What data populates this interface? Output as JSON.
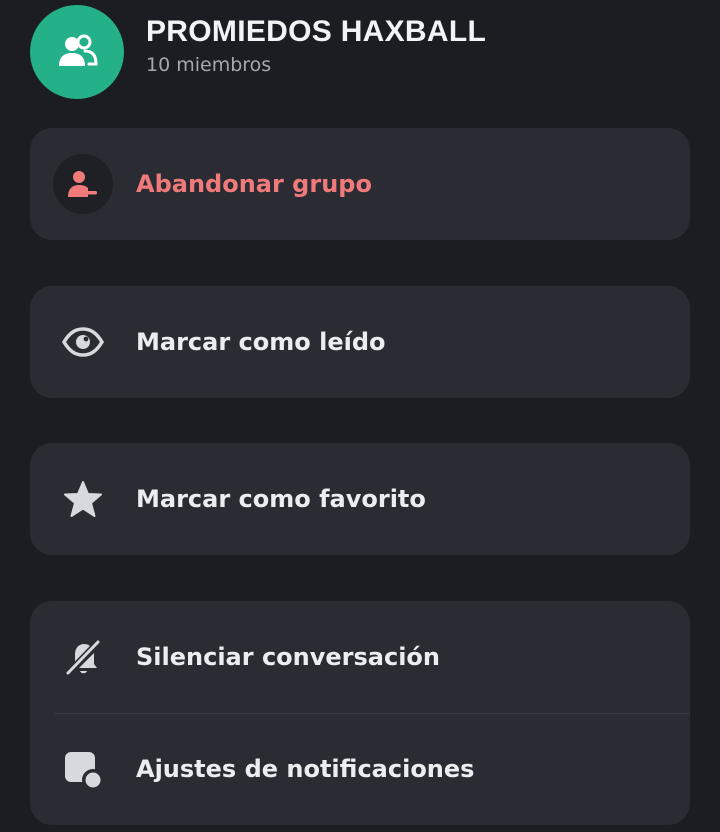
{
  "group": {
    "name": "PROMIEDOS HAXBALL",
    "members": "10 miembros",
    "avatar_icon": "group-icon",
    "avatar_color": "#24b089"
  },
  "actions": {
    "leave": {
      "label": "Abandonar grupo",
      "icon": "leave-group-icon",
      "color": "#f07a7a"
    },
    "mark_read": {
      "label": "Marcar como leído",
      "icon": "eye-icon"
    },
    "favorite": {
      "label": "Marcar como favorito",
      "icon": "star-icon"
    },
    "mute": {
      "label": "Silenciar conversación",
      "icon": "bell-muted-icon"
    },
    "notifications": {
      "label": "Ajustes de notificaciones",
      "icon": "notification-settings-icon"
    }
  },
  "colors": {
    "background": "#1c1d22",
    "card": "#2a2b33",
    "text": "#ecedf0",
    "subtext": "#a4a7ae"
  }
}
